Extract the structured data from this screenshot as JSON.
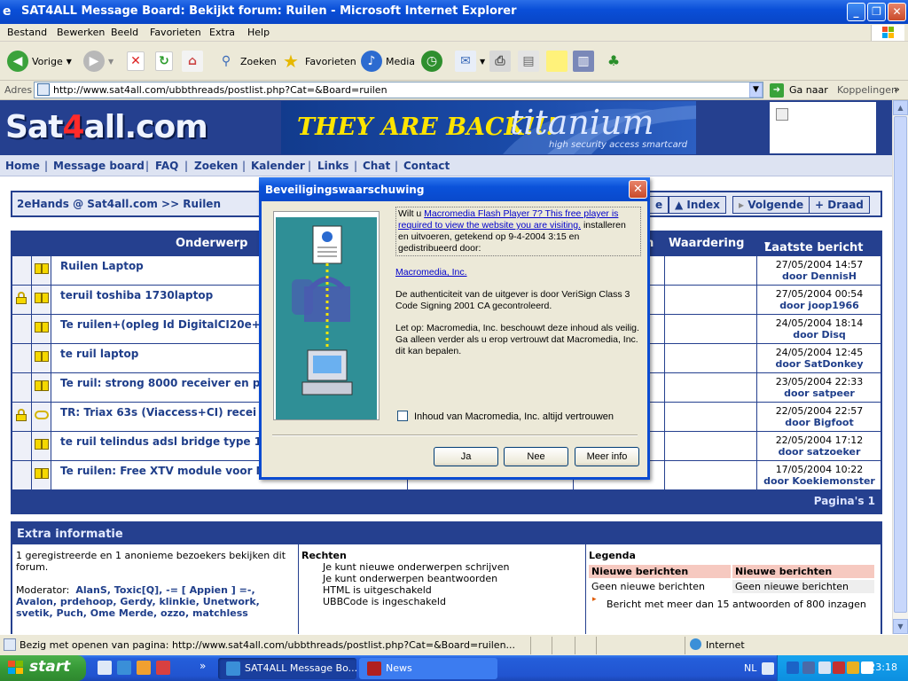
{
  "window": {
    "title": "SAT4ALL Message Board: Bekijkt forum: Ruilen - Microsoft Internet Explorer",
    "buttons": [
      "_",
      "❐",
      "✕"
    ]
  },
  "menu": [
    "Bestand",
    "Bewerken",
    "Beeld",
    "Favorieten",
    "Extra",
    "Help"
  ],
  "toolbar": {
    "back": "Vorige",
    "search": "Zoeken",
    "favorites": "Favorieten",
    "media": "Media"
  },
  "address": {
    "label": "Adres",
    "url": "http://www.sat4all.com/ubbthreads/postlist.php?Cat=&Board=ruilen",
    "go": "Ga naar",
    "links": "Koppelingen",
    "more": "»"
  },
  "site": {
    "logo_a": "Sat",
    "logo_b": "4",
    "logo_c": "all.com",
    "banner_text": "THEY ARE BACK!!!",
    "banner_brand": "titanium",
    "banner_tagline": "high security access smartcard",
    "nav": [
      "Home",
      "Message board",
      "FAQ",
      "Zoeken",
      "Kalender",
      "Links",
      "Chat",
      "Contact"
    ]
  },
  "breadcrumb": {
    "text": "2eHands @ Sat4all.com >> Ruilen",
    "buttons": {
      "partial": "e",
      "index": "Index",
      "next": "Volgende",
      "thread": "Draad"
    }
  },
  "threads": {
    "headers": {
      "subject": "Onderwerp",
      "partial": "n",
      "rating": "Waardering",
      "last_post": "Laatste bericht"
    },
    "rows": [
      {
        "locked": false,
        "icon": "book",
        "subject": "Ruilen Laptop",
        "date": "27/05/2004 14:57",
        "by": "door DennisH"
      },
      {
        "locked": true,
        "icon": "book",
        "subject": "teruil toshiba 1730laptop",
        "date": "27/05/2004 00:54",
        "by": "door joop1966"
      },
      {
        "locked": false,
        "icon": "book",
        "subject": "Te ruilen+(opleg Id DigitalCI20e+",
        "date": "24/05/2004 18:14",
        "by": "door Disq"
      },
      {
        "locked": false,
        "icon": "book",
        "subject": "te ruil laptop",
        "date": "24/05/2004 12:45",
        "by": "door SatDonkey"
      },
      {
        "locked": false,
        "icon": "book",
        "subject": "Te ruil: strong 8000 receiver en p",
        "date": "23/05/2004 22:33",
        "by": "door satpeer"
      },
      {
        "locked": true,
        "icon": "chain",
        "subject": "TR: Triax 63s (Viaccess+CI) recei",
        "date": "22/05/2004 22:57",
        "by": "door Bigfoot"
      },
      {
        "locked": false,
        "icon": "book",
        "subject": "te ruil telindus adsl bridge type 11",
        "date": "22/05/2004 17:12",
        "by": "door satzoeker"
      },
      {
        "locked": false,
        "icon": "book",
        "subject": "Te ruilen: Free XTV module voor M",
        "date": "17/05/2004 10:22",
        "by": "door Koekiemonster"
      }
    ],
    "pagination": "Pagina's 1"
  },
  "extra": {
    "title": "Extra informatie",
    "visitors": "1 geregistreerde en 1 anonieme bezoekers bekijken dit forum.",
    "moderator_label": "Moderator:",
    "moderators": "AlanS, Toxic[Q], -= [ Appien ] =-, Avalon, prdehoop, Gerdy, klinkie, Unetwork, svetik, Puch, Ome Merde, ozzo, matchless",
    "rights_title": "Rechten",
    "rights": [
      "Je kunt nieuwe onderwerpen schrijven",
      "Je kunt onderwerpen beantwoorden",
      "HTML is uitgeschakeld",
      "UBBCode is ingeschakeld"
    ],
    "legend_title": "Legenda",
    "legend_new_a": "Nieuwe berichten",
    "legend_new_b": "Nieuwe berichten",
    "legend_none_a": "Geen nieuwe berichten",
    "legend_none_b": "Geen nieuwe berichten",
    "legend_hot": "Bericht met meer dan 15 antwoorden of 800 inzagen"
  },
  "dialog": {
    "title": "Beveiligingswaarschuwing",
    "intro_pre": "Wilt u ",
    "intro_link": "Macromedia Flash Player 7?  This free player is required to view the website you are visiting.",
    "intro_post": " installeren en uitvoeren, getekend op 9-4-2004 3:15 en gedistribueerd door:",
    "publisher": "Macromedia, Inc.",
    "auth": "De authenticiteit van de uitgever is door VeriSign Class 3 Code Signing 2001 CA gecontroleerd.",
    "caution": "Let op: Macromedia, Inc. beschouwt deze inhoud als veilig. Ga alleen verder als u erop vertrouwt dat Macromedia, Inc. dit kan bepalen.",
    "checkbox_label": "Inhoud van Macromedia, Inc. altijd vertrouwen",
    "checkbox_checked": false,
    "btn_yes": "Ja",
    "btn_no": "Nee",
    "btn_more": "Meer info"
  },
  "statusbar": {
    "text": "Bezig met openen van pagina: http://www.sat4all.com/ubbthreads/postlist.php?Cat=&Board=ruilen...",
    "zone": "Internet"
  },
  "taskbar": {
    "start": "start",
    "more": "»",
    "tasks": [
      "SAT4ALL Message Bo...",
      "News"
    ],
    "lang": "NL",
    "clock": "23:18"
  }
}
